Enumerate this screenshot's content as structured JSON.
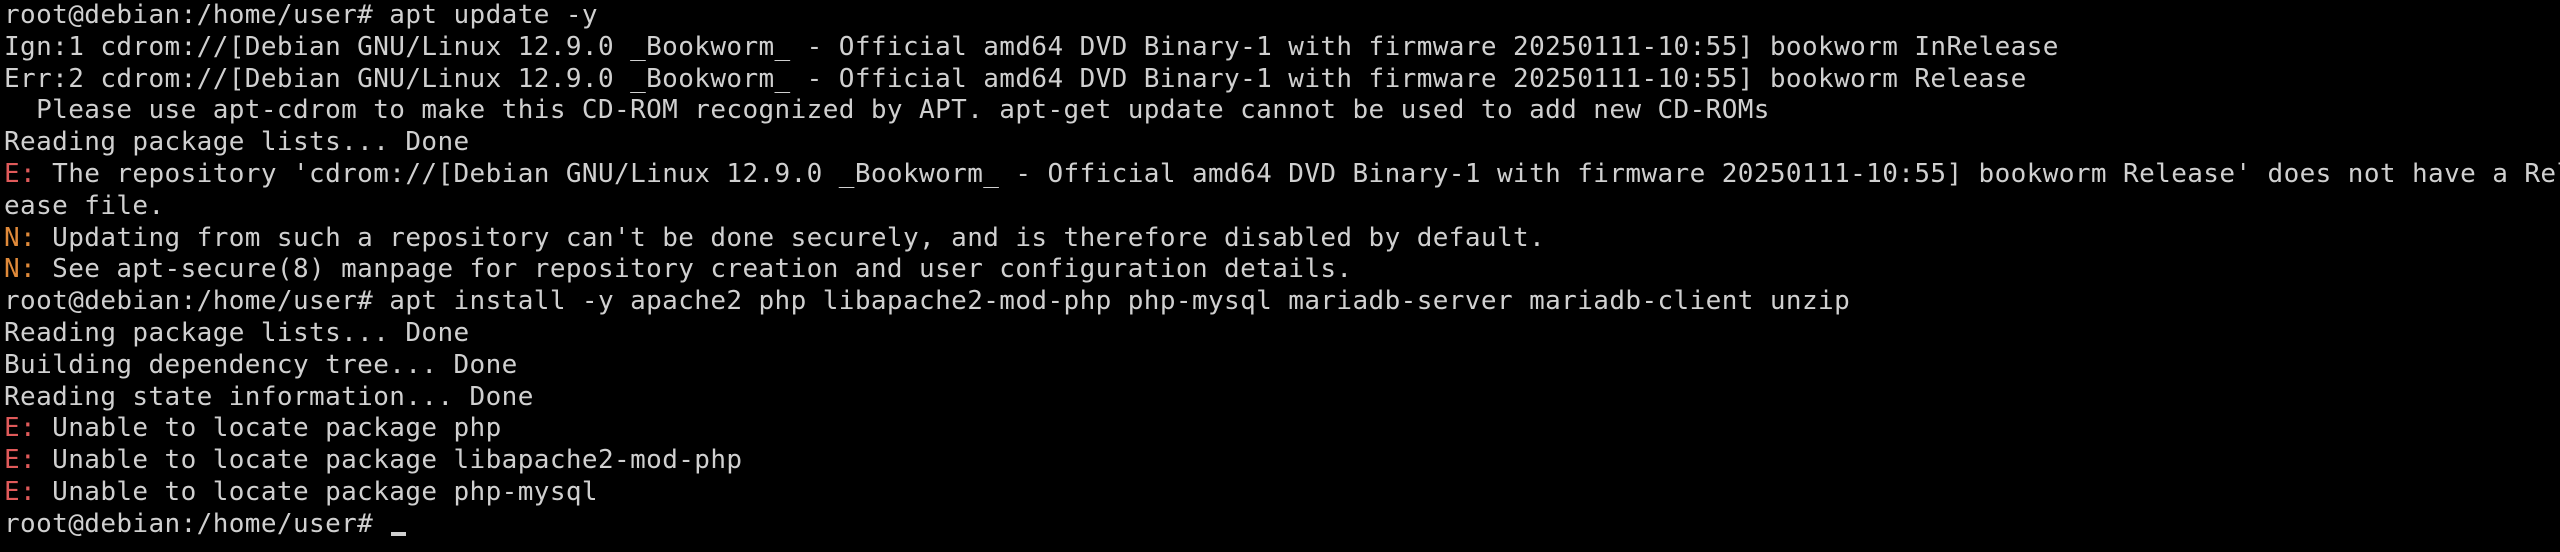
{
  "terminal": {
    "lines": [
      {
        "prefix": "",
        "text": "root@debian:/home/user# apt update -y"
      },
      {
        "prefix": "",
        "text": "Ign:1 cdrom://[Debian GNU/Linux 12.9.0 _Bookworm_ - Official amd64 DVD Binary-1 with firmware 20250111-10:55] bookworm InRelease"
      },
      {
        "prefix": "",
        "text": "Err:2 cdrom://[Debian GNU/Linux 12.9.0 _Bookworm_ - Official amd64 DVD Binary-1 with firmware 20250111-10:55] bookworm Release"
      },
      {
        "prefix": "",
        "text": "  Please use apt-cdrom to make this CD-ROM recognized by APT. apt-get update cannot be used to add new CD-ROMs"
      },
      {
        "prefix": "",
        "text": "Reading package lists... Done"
      },
      {
        "prefix": "E:",
        "text": " The repository 'cdrom://[Debian GNU/Linux 12.9.0 _Bookworm_ - Official amd64 DVD Binary-1 with firmware 20250111-10:55] bookworm Release' does not have a Rel"
      },
      {
        "prefix": "",
        "text": "ease file."
      },
      {
        "prefix": "N:",
        "text": " Updating from such a repository can't be done securely, and is therefore disabled by default."
      },
      {
        "prefix": "N:",
        "text": " See apt-secure(8) manpage for repository creation and user configuration details."
      },
      {
        "prefix": "",
        "text": "root@debian:/home/user# apt install -y apache2 php libapache2-mod-php php-mysql mariadb-server mariadb-client unzip"
      },
      {
        "prefix": "",
        "text": "Reading package lists... Done"
      },
      {
        "prefix": "",
        "text": "Building dependency tree... Done"
      },
      {
        "prefix": "",
        "text": "Reading state information... Done"
      },
      {
        "prefix": "E:",
        "text": " Unable to locate package php"
      },
      {
        "prefix": "E:",
        "text": " Unable to locate package libapache2-mod-php"
      },
      {
        "prefix": "E:",
        "text": " Unable to locate package php-mysql"
      }
    ],
    "prompt": "root@debian:/home/user# ",
    "colors": {
      "background": "#000000",
      "foreground": "#d0d0d0",
      "error_prefix": "#e05a5a",
      "notice_prefix": "#e08a3a"
    }
  }
}
